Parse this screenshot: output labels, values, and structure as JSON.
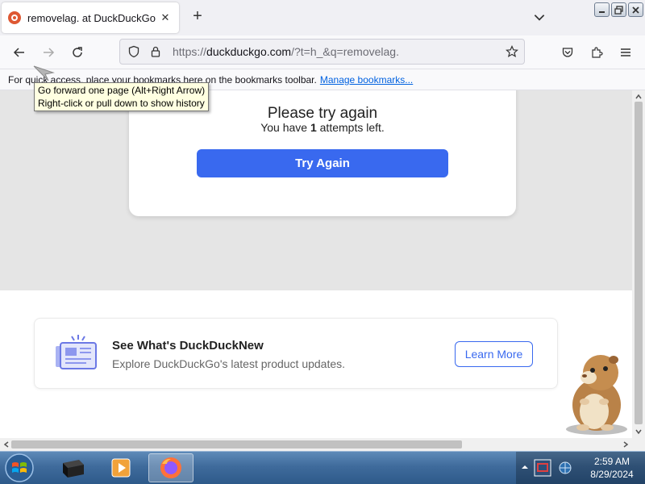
{
  "tab": {
    "title": "removelag. at DuckDuckGo",
    "close": "✕",
    "new_tab": "+"
  },
  "url": {
    "prefix": "https://",
    "host": "duckduckgo.com",
    "path": "/?t=h_&q=removelag."
  },
  "bookmarks_bar": {
    "text": "For quick access, place your bookmarks here on the bookmarks toolbar.",
    "link": "Manage bookmarks..."
  },
  "tooltip": {
    "line1": "Go forward one page (Alt+Right Arrow)",
    "line2": "Right-click or pull down to show history"
  },
  "error_card": {
    "title": "Please try again",
    "attempts_prefix": "You have ",
    "attempts_count": "1",
    "attempts_suffix": " attempts left.",
    "button": "Try Again"
  },
  "news": {
    "title": "See What's DuckDuckNew",
    "subtitle": "Explore DuckDuckGo's latest product updates.",
    "button": "Learn More"
  },
  "clock": {
    "time": "2:59 AM",
    "date": "8/29/2024"
  },
  "colors": {
    "accent": "#3969ef",
    "ddg_orange": "#de5833",
    "tooltip_bg": "#ffffe1"
  },
  "icons": [
    "back-icon",
    "forward-icon",
    "reload-icon",
    "shield-icon",
    "lock-icon",
    "star-icon",
    "pocket-icon",
    "extensions-icon",
    "menu-icon"
  ]
}
